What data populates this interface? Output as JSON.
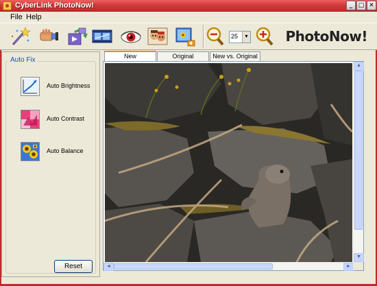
{
  "window": {
    "title": "CyberLink PhotoNow!",
    "minimize": "_",
    "maximize": "□",
    "close": "✕",
    "accent": "#d43a3a"
  },
  "menu": {
    "file": "File",
    "help": "Help"
  },
  "toolbar": {
    "tools": [
      {
        "icon": "magic-wand-icon"
      },
      {
        "icon": "fix-hand-icon"
      },
      {
        "icon": "rotate-icon"
      },
      {
        "icon": "filmstrip-icon"
      },
      {
        "icon": "red-eye-icon"
      },
      {
        "icon": "faces-icon"
      },
      {
        "icon": "picture-export-icon"
      }
    ],
    "zoom_out_icon": "zoom-out-icon",
    "zoom_in_icon": "zoom-in-icon",
    "zoom_value": "25",
    "brand": "PhotoNow!"
  },
  "auto_fix": {
    "title": "Auto Fix",
    "items": [
      {
        "label": "Auto Brightness",
        "icon": "brightness-graph-icon"
      },
      {
        "label": "Auto Contrast",
        "icon": "contrast-icon"
      },
      {
        "label": "Auto Balance",
        "icon": "sunflower-icon"
      }
    ],
    "reset": "Reset"
  },
  "tabs": [
    {
      "label": "New",
      "active": true
    },
    {
      "label": "Original",
      "active": false
    },
    {
      "label": "New vs. Original",
      "active": false
    }
  ],
  "viewport": {
    "scroll_up": "▲",
    "scroll_down": "▼",
    "scroll_left": "◄",
    "scroll_right": "►"
  }
}
